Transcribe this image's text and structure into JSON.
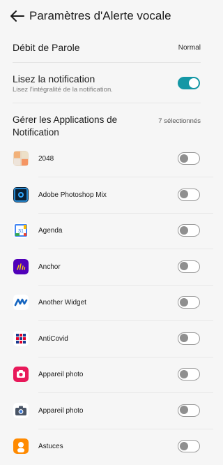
{
  "header": {
    "title": "Paramètres d'Alerte vocale",
    "back_icon": "arrow-left-icon"
  },
  "speech_rate": {
    "label": "Débit de Parole",
    "value": "Normal"
  },
  "read_notification": {
    "label": "Lisez la notification",
    "description": "Lisez l'intégralité de la notification.",
    "enabled": true,
    "accent_color": "#1497a5"
  },
  "manage_apps": {
    "label": "Gérer les Applications de Notification",
    "count_label": "7 sélectionnés"
  },
  "apps": [
    {
      "name": "2048",
      "icon": "app-2048-icon",
      "enabled": false
    },
    {
      "name": "Adobe Photoshop Mix",
      "icon": "photoshop-mix-icon",
      "enabled": false
    },
    {
      "name": "Agenda",
      "icon": "google-calendar-icon",
      "enabled": false
    },
    {
      "name": "Anchor",
      "icon": "anchor-icon",
      "enabled": false
    },
    {
      "name": "Another Widget",
      "icon": "another-widget-icon",
      "enabled": false
    },
    {
      "name": "AntiCovid",
      "icon": "anticovid-icon",
      "enabled": false
    },
    {
      "name": "Appareil photo",
      "icon": "camera-pink-icon",
      "enabled": false
    },
    {
      "name": "Appareil photo",
      "icon": "camera-gray-icon",
      "enabled": false
    },
    {
      "name": "Astuces",
      "icon": "tips-icon",
      "enabled": false
    }
  ]
}
